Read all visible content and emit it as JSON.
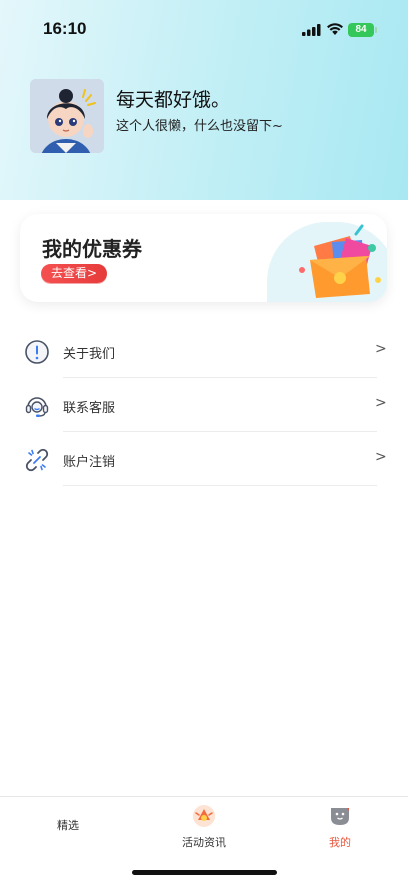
{
  "status_bar": {
    "time": "16:10",
    "battery": "84",
    "icons": [
      "signal-icon",
      "wifi-icon",
      "battery-icon"
    ]
  },
  "profile": {
    "nickname": "每天都好饿。",
    "signature": "这个人很懒，什么也没留下~"
  },
  "coupon": {
    "title": "我的优惠券",
    "button_label": "去查看>"
  },
  "menu": {
    "items": [
      {
        "label": "关于我们",
        "icon": "info-icon",
        "chevron": ">"
      },
      {
        "label": "联系客服",
        "icon": "headset-icon",
        "chevron": ">"
      },
      {
        "label": "账户注销",
        "icon": "broken-link-icon",
        "chevron": ">"
      }
    ]
  },
  "tab_bar": {
    "tabs": [
      {
        "label": "精选",
        "icon": null,
        "active": false
      },
      {
        "label": "活动资讯",
        "icon": "activity-icon",
        "active": false
      },
      {
        "label": "我的",
        "icon": "profile-icon",
        "active": true
      }
    ]
  },
  "colors": {
    "header_gradient_start": "#e4f7fb",
    "header_gradient_end": "#a8e8f2",
    "accent_red": "#e84a3c",
    "coupon_button": "#f04848",
    "active_tab": "#e8583d"
  }
}
